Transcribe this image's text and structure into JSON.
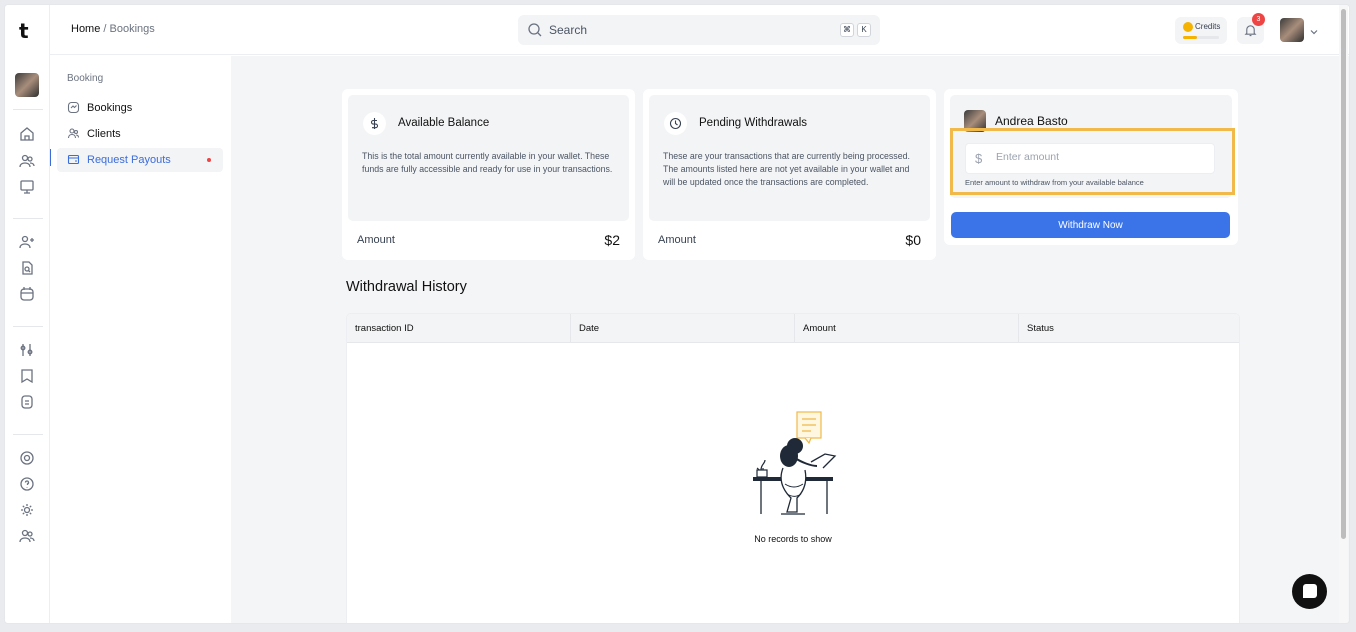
{
  "app": {
    "logo_letter": "t"
  },
  "breadcrumb": {
    "home": "Home",
    "separator": "/",
    "current": "Bookings"
  },
  "search": {
    "placeholder": "Search",
    "shortcut_cmd": "⌘",
    "shortcut_key": "K"
  },
  "header": {
    "credits_label": "Credits",
    "credits_progress": 0.4,
    "notification_count": "3"
  },
  "subnav": {
    "group_label": "Booking",
    "items": [
      {
        "label": "Bookings",
        "icon": "bookings-icon"
      },
      {
        "label": "Clients",
        "icon": "clients-icon"
      },
      {
        "label": "Request Payouts",
        "icon": "payouts-icon",
        "active": true
      }
    ]
  },
  "cards": {
    "available": {
      "title": "Available Balance",
      "icon": "dollar-icon",
      "description": "This is the total amount currently available in your wallet. These funds are fully accessible and ready for use in your transactions.",
      "amount_label": "Amount",
      "amount_value": "$2"
    },
    "pending": {
      "title": "Pending Withdrawals",
      "icon": "clock-icon",
      "description": "These are your transactions that are currently being processed. The amounts listed here are not yet available in your wallet and will be updated once the transactions are completed.",
      "amount_label": "Amount",
      "amount_value": "$0"
    }
  },
  "withdraw": {
    "user_name": "Andrea Basto",
    "currency_symbol": "$",
    "amount_placeholder": "Enter amount",
    "hint": "Enter amount to withdraw from your available balance",
    "button_label": "Withdraw Now"
  },
  "history": {
    "title": "Withdrawal History",
    "columns": [
      "transaction ID",
      "Date",
      "Amount",
      "Status"
    ],
    "rows": [],
    "empty_text": "No records to show"
  },
  "colors": {
    "accent": "#3b74e8",
    "highlight": "#f0b94a",
    "badge": "#ef4444",
    "credits": "#f5b200"
  }
}
